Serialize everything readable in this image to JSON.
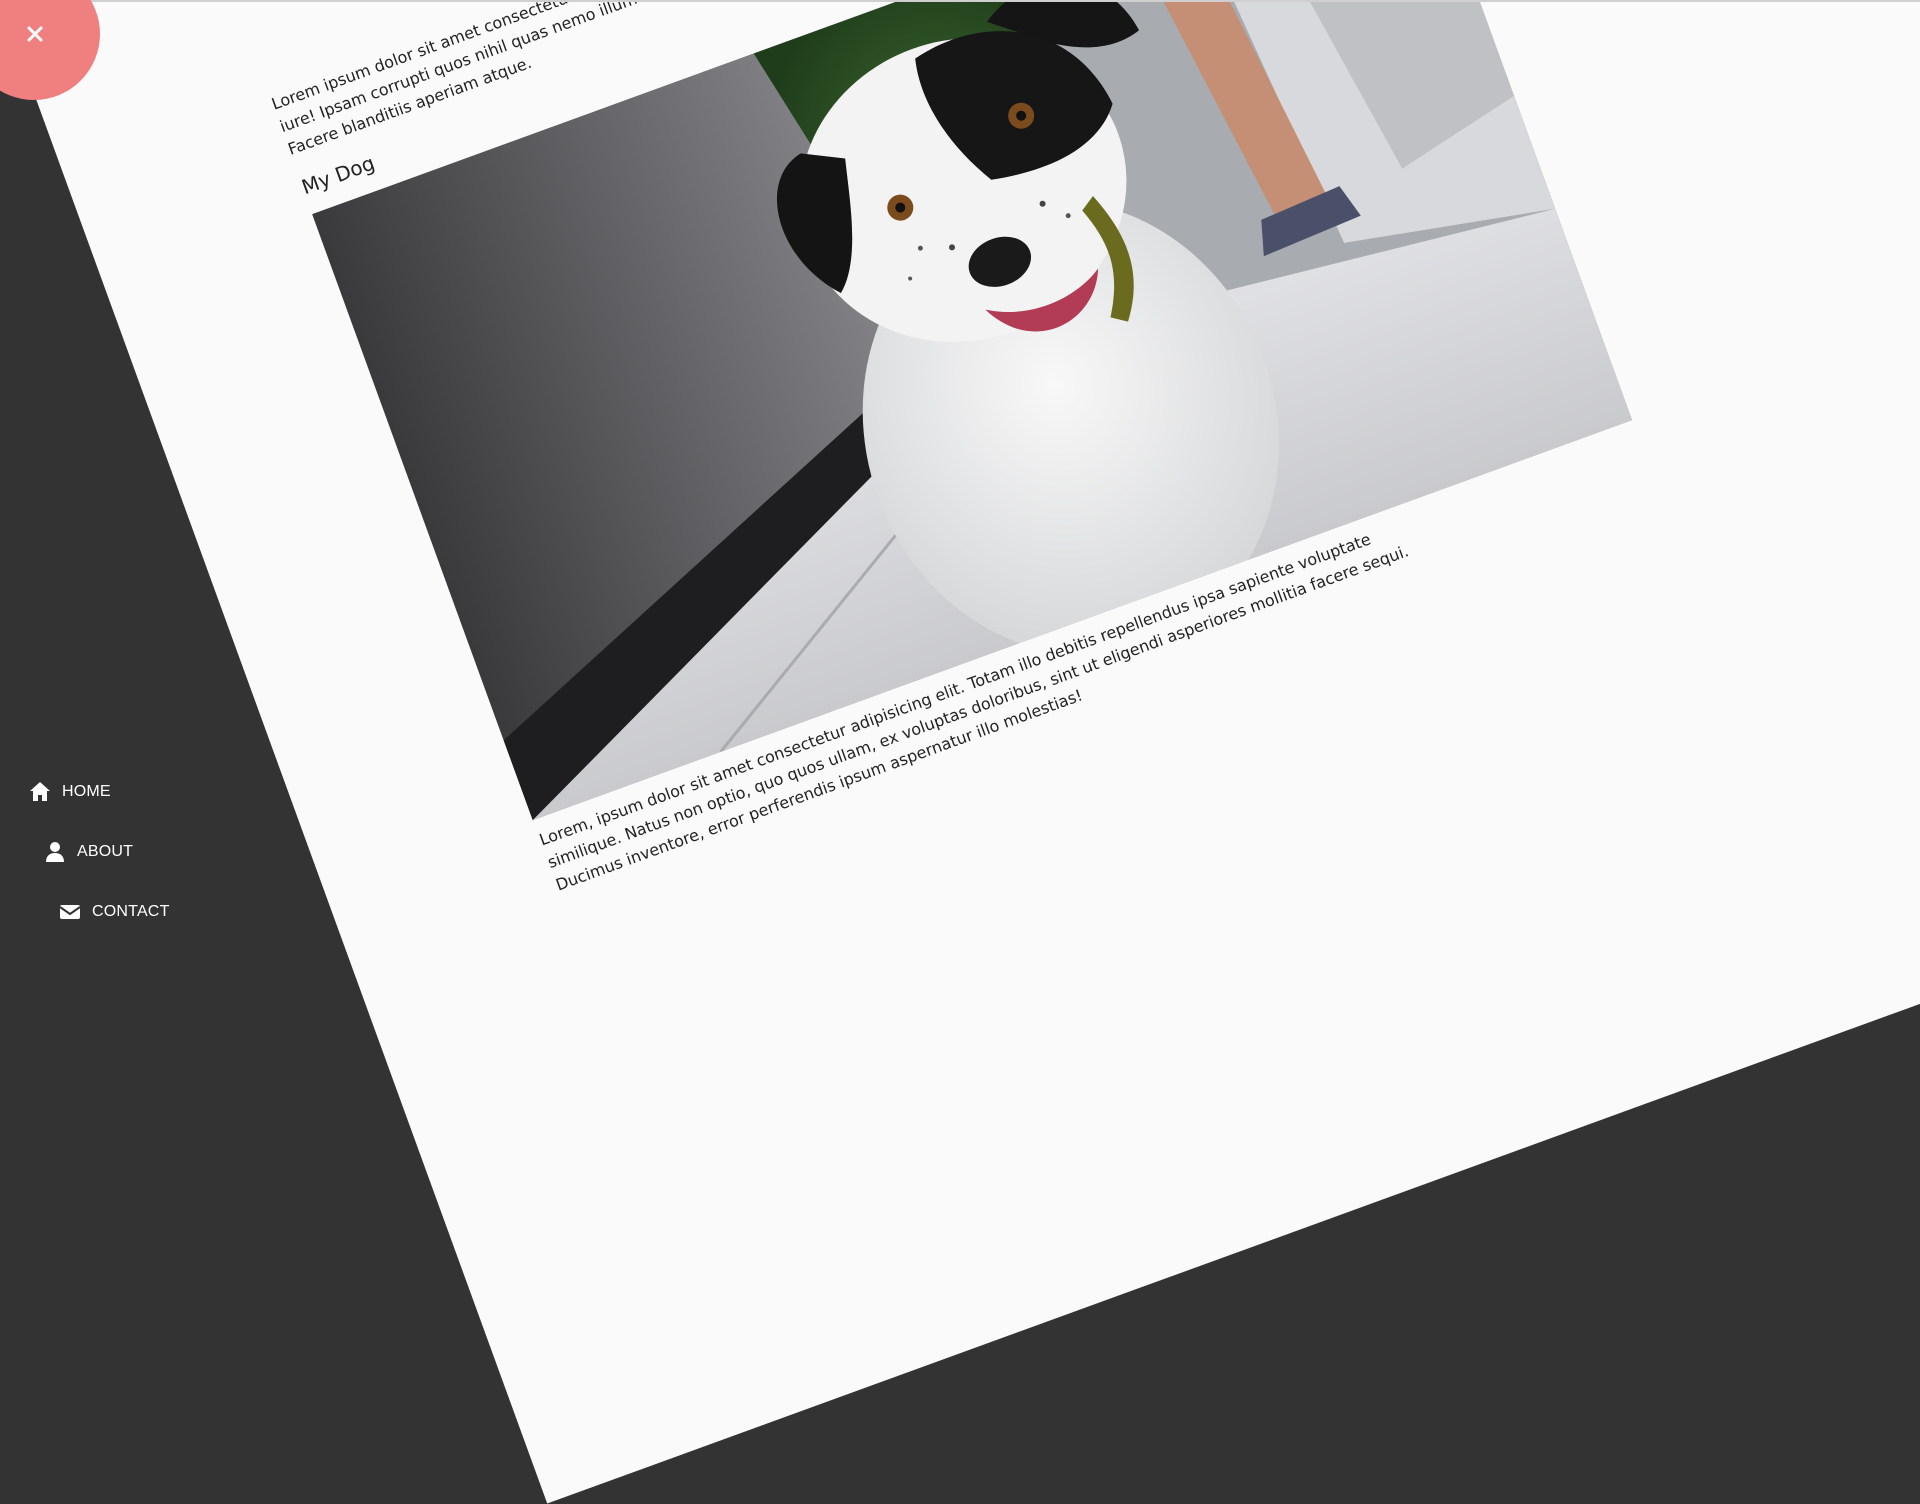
{
  "close_button": {
    "icon": "close-icon",
    "color": "#f08080"
  },
  "nav": {
    "items": [
      {
        "label": "HOME",
        "icon": "home-icon"
      },
      {
        "label": "ABOUT",
        "icon": "user-icon"
      },
      {
        "label": "CONTACT",
        "icon": "envelope-icon"
      }
    ]
  },
  "article": {
    "intro": "Lorem ipsum dolor sit amet consectetur adipisicing elit. Accusamus exercitationem, accusantium ut. Laboriosam, accusantium ut. Laboriosam iure! Ipsam corrupti quos nihil quas nemo illum voluptate similique. Quisquam commodi nemo illum voluptate similique. Cumque, libero facere! Facere blanditiis aperiam atque.",
    "section_title": "My Dog",
    "photo_alt": "dog-photo",
    "caption": "Lorem, ipsum dolor sit amet consectetur adipisicing elit. Totam illo debitis repellendus ipsa sapiente voluptate similique. Natus non optio, quo quos ullam, ex voluptas doloribus, sint ut eligendi asperiores mollitia facere sequi. Ducimus inventore, error perferendis ipsum aspernatur illo molestias!"
  },
  "colors": {
    "background": "#333333",
    "page": "#fafafa",
    "accent": "#f08080",
    "nav_text": "#ffffff"
  }
}
